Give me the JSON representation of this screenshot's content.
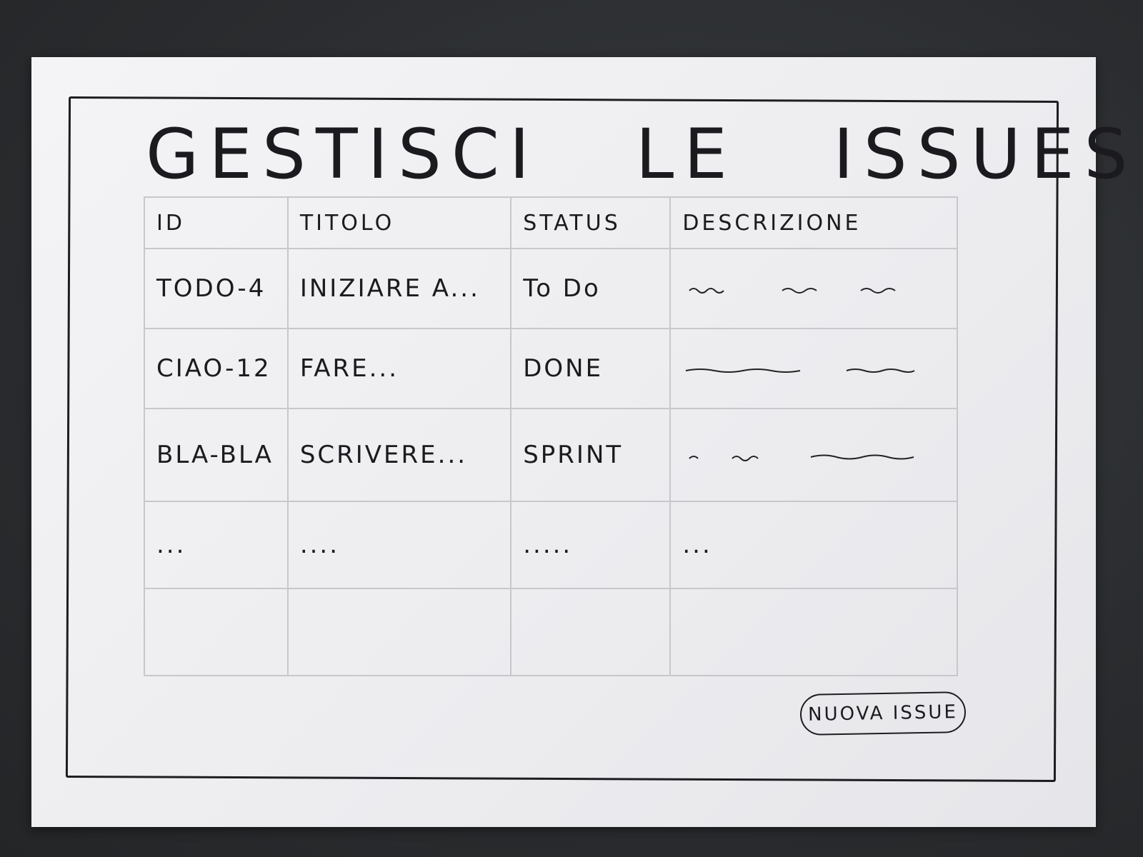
{
  "page": {
    "title": "GESTISCI LE ISSUES"
  },
  "table": {
    "columns": [
      "ID",
      "TITOLO",
      "STATUS",
      "DESCRIZIONE"
    ],
    "rows": [
      {
        "id": "TODO-4",
        "titolo": "INIZIARE A...",
        "status": "To Do"
      },
      {
        "id": "CIAO-12",
        "titolo": "FARE...",
        "status": "DONE"
      },
      {
        "id": "BLA-BLA",
        "titolo": "SCRIVERE...",
        "status": "SPRINT"
      },
      {
        "id": "...",
        "titolo": "....",
        "status": ".....",
        "descrizione": "..."
      }
    ]
  },
  "actions": {
    "new_issue_label": "NUOVA ISSUE"
  }
}
